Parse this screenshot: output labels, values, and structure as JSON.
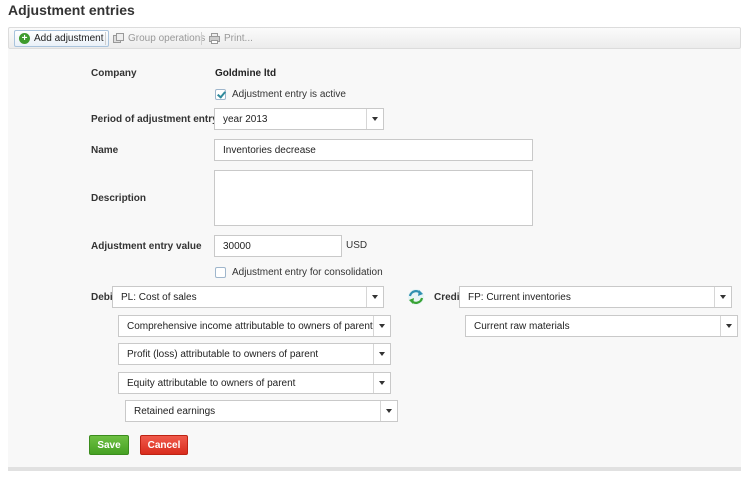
{
  "page_title": "Adjustment entries",
  "toolbar": {
    "add_adjustment": "Add adjustment",
    "group_operations": "Group operations",
    "print": "Print..."
  },
  "form": {
    "company_label": "Company",
    "company_value": "Goldmine ltd",
    "active_checkbox_label": "Adjustment entry is active",
    "active_checked": true,
    "period_label": "Period of adjustment entry",
    "period_value": "year 2013",
    "name_label": "Name",
    "name_value": "Inventories decrease",
    "description_label": "Description",
    "description_value": "",
    "value_label": "Adjustment entry value",
    "value_amount": "30000",
    "currency": "USD",
    "consolidation_checkbox_label": "Adjustment entry for consolidation",
    "consolidation_checked": false,
    "debit_label": "Debit",
    "debit_value": "PL: Cost of sales",
    "debit_sub": [
      "Comprehensive income attributable to owners of parent",
      "Profit (loss) attributable to owners of parent",
      "Equity attributable to owners of parent",
      "Retained earnings"
    ],
    "credit_label": "Credit",
    "credit_value": "FP: Current inventories",
    "credit_sub": [
      "Current raw materials"
    ],
    "save_button": "Save",
    "cancel_button": "Cancel"
  },
  "colors": {
    "save": "#46a123",
    "cancel": "#d92c1d",
    "check": "#2f8a9c"
  }
}
